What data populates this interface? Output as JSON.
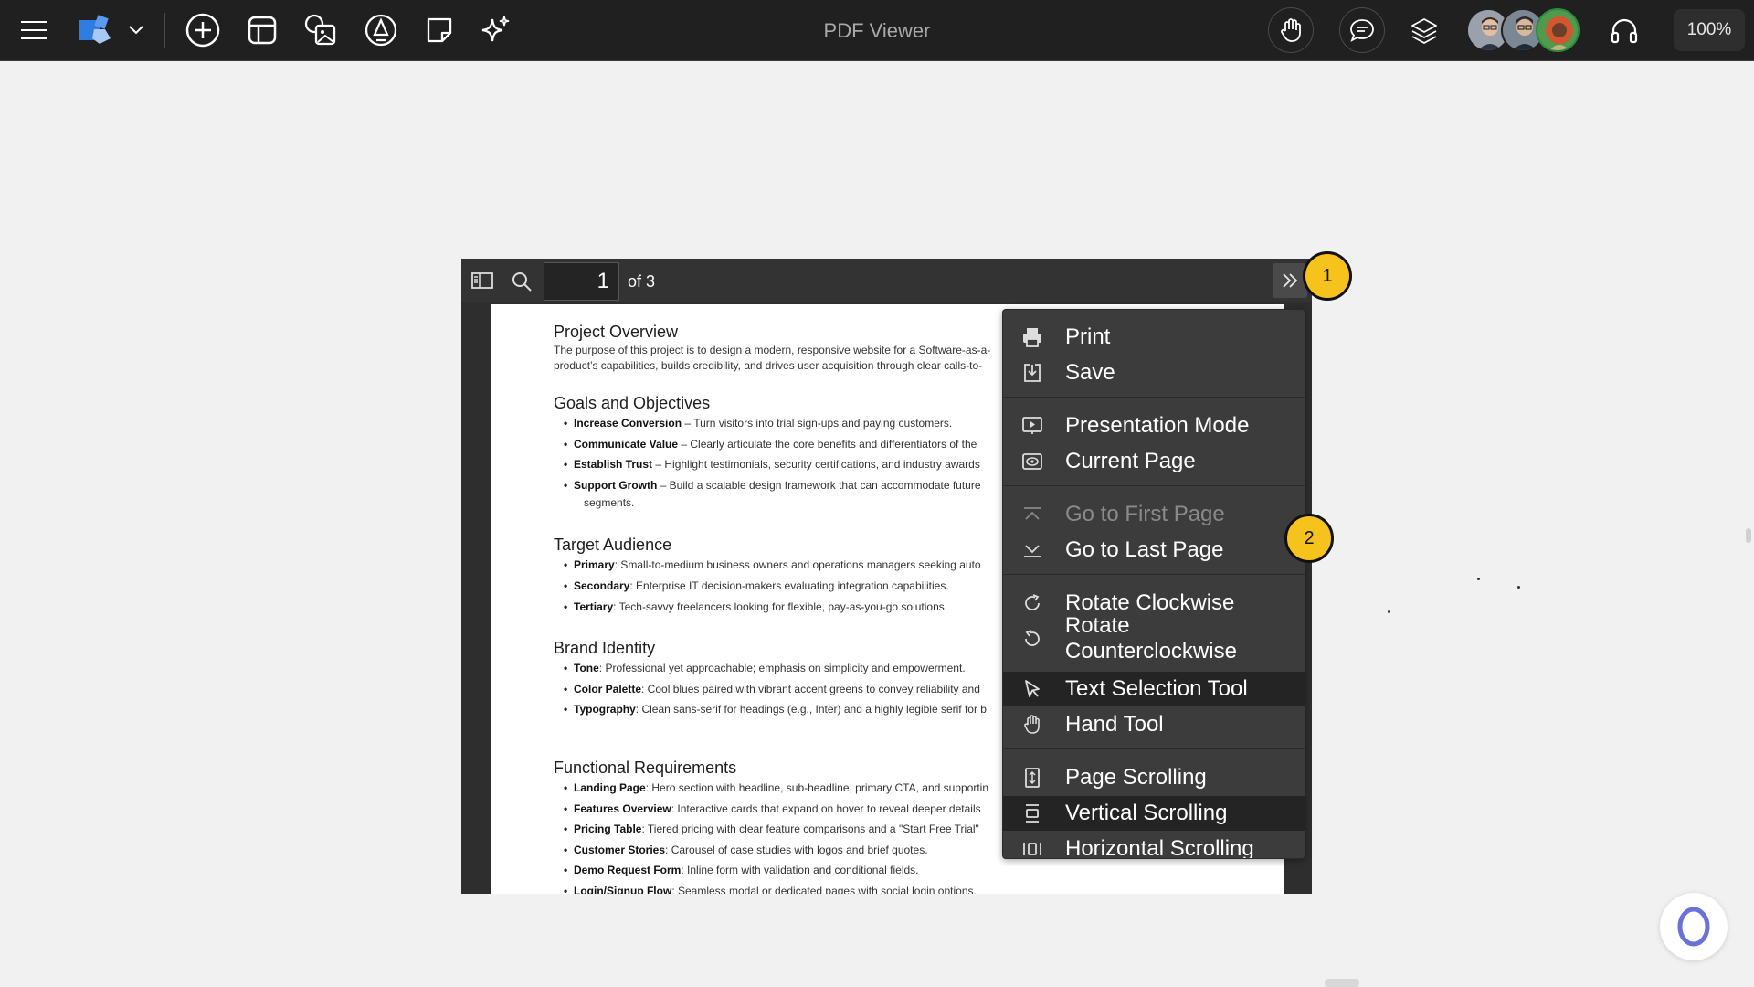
{
  "app": {
    "title": "PDF Viewer",
    "zoom": "100%"
  },
  "topbar": {
    "icons": [
      "menu-icon",
      "shapes-icon",
      "chevron-down-icon",
      "add-icon",
      "layout-icon",
      "image-icon",
      "pen-icon",
      "sticky-note-icon",
      "sparkle-icon",
      "hand-icon",
      "comment-icon",
      "layers-icon",
      "headphones-icon"
    ],
    "avatars": 3
  },
  "viewer": {
    "page_number": "1",
    "page_of": "of 3"
  },
  "document": {
    "sections": [
      {
        "title": "Project Overview",
        "paragraph": [
          "The purpose of this project is to design a modern, responsive website for a Software-as-a-",
          "product’s capabilities, builds credibility, and drives user acquisition through clear calls-to-"
        ]
      },
      {
        "title": "Goals and Objectives",
        "bullets": [
          {
            "label": "Increase Conversion",
            "text": " – Turn visitors into trial sign-ups and paying customers."
          },
          {
            "label": "Communicate Value",
            "text": " – Clearly articulate the core benefits and differentiators of the"
          },
          {
            "label": "Establish Trust",
            "text": " – Highlight testimonials, security certifications, and industry awards"
          },
          {
            "label": "Support Growth",
            "text": " – Build a scalable design framework that can accommodate future"
          }
        ],
        "continuation": "segments."
      },
      {
        "title": "Target Audience",
        "bullets": [
          {
            "label": "Primary",
            "text": ": Small-to-medium business owners and operations managers seeking auto"
          },
          {
            "label": "Secondary",
            "text": ": Enterprise IT decision-makers evaluating integration capabilities."
          },
          {
            "label": "Tertiary",
            "text": ": Tech-savvy freelancers looking for flexible, pay-as-you-go solutions."
          }
        ]
      },
      {
        "title": "Brand Identity",
        "bullets": [
          {
            "label": "Tone",
            "text": ": Professional yet approachable; emphasis on simplicity and empowerment."
          },
          {
            "label": "Color Palette",
            "text": ": Cool blues paired with vibrant accent greens to convey reliability and"
          },
          {
            "label": "Typography",
            "text": ": Clean sans-serif for headings (e.g., Inter) and a highly legible serif for b"
          }
        ]
      },
      {
        "title": "Functional Requirements",
        "bullets": [
          {
            "label": "Landing Page",
            "text": ": Hero section with headline, sub-headline, primary CTA, and supportin"
          },
          {
            "label": "Features Overview",
            "text": ": Interactive cards that expand on hover to reveal deeper details"
          },
          {
            "label": "Pricing Table",
            "text": ": Tiered pricing with clear feature comparisons and a \"Start Free Trial\""
          },
          {
            "label": "Customer Stories",
            "text": ": Carousel of case studies with logos and brief quotes."
          },
          {
            "label": "Demo Request Form",
            "text": ": Inline form with validation and conditional fields."
          },
          {
            "label": "Login/Signup Flow",
            "text": ": Seamless modal or dedicated pages with social login options."
          }
        ]
      }
    ]
  },
  "menu": {
    "items": [
      {
        "label": "Print",
        "icon": "printer-icon"
      },
      {
        "label": "Save",
        "icon": "save-icon"
      },
      {
        "label": "Presentation Mode",
        "icon": "presentation-icon"
      },
      {
        "label": "Current Page",
        "icon": "eye-icon"
      },
      {
        "label": "Go to First Page",
        "icon": "first-page-icon",
        "disabled": true
      },
      {
        "label": "Go to Last Page",
        "icon": "last-page-icon"
      },
      {
        "label": "Rotate Clockwise",
        "icon": "rotate-clockwise-icon"
      },
      {
        "label": "Rotate Counterclockwise",
        "icon": "rotate-counterclockwise-icon"
      },
      {
        "label": "Text Selection Tool",
        "icon": "cursor-icon",
        "active": true
      },
      {
        "label": "Hand Tool",
        "icon": "hand-icon"
      },
      {
        "label": "Page Scrolling",
        "icon": "page-scrolling-icon"
      },
      {
        "label": "Vertical Scrolling",
        "icon": "vertical-scrolling-icon",
        "active": true
      },
      {
        "label": "Horizontal Scrolling",
        "icon": "horizontal-scrolling-icon"
      }
    ]
  },
  "annotations": {
    "badge1": "1",
    "badge2": "2"
  },
  "colors": {
    "topbar": "#202020",
    "menu": "#3c3c3c",
    "badge": "#f5c31b",
    "accent_blue": "#2f7de1"
  }
}
